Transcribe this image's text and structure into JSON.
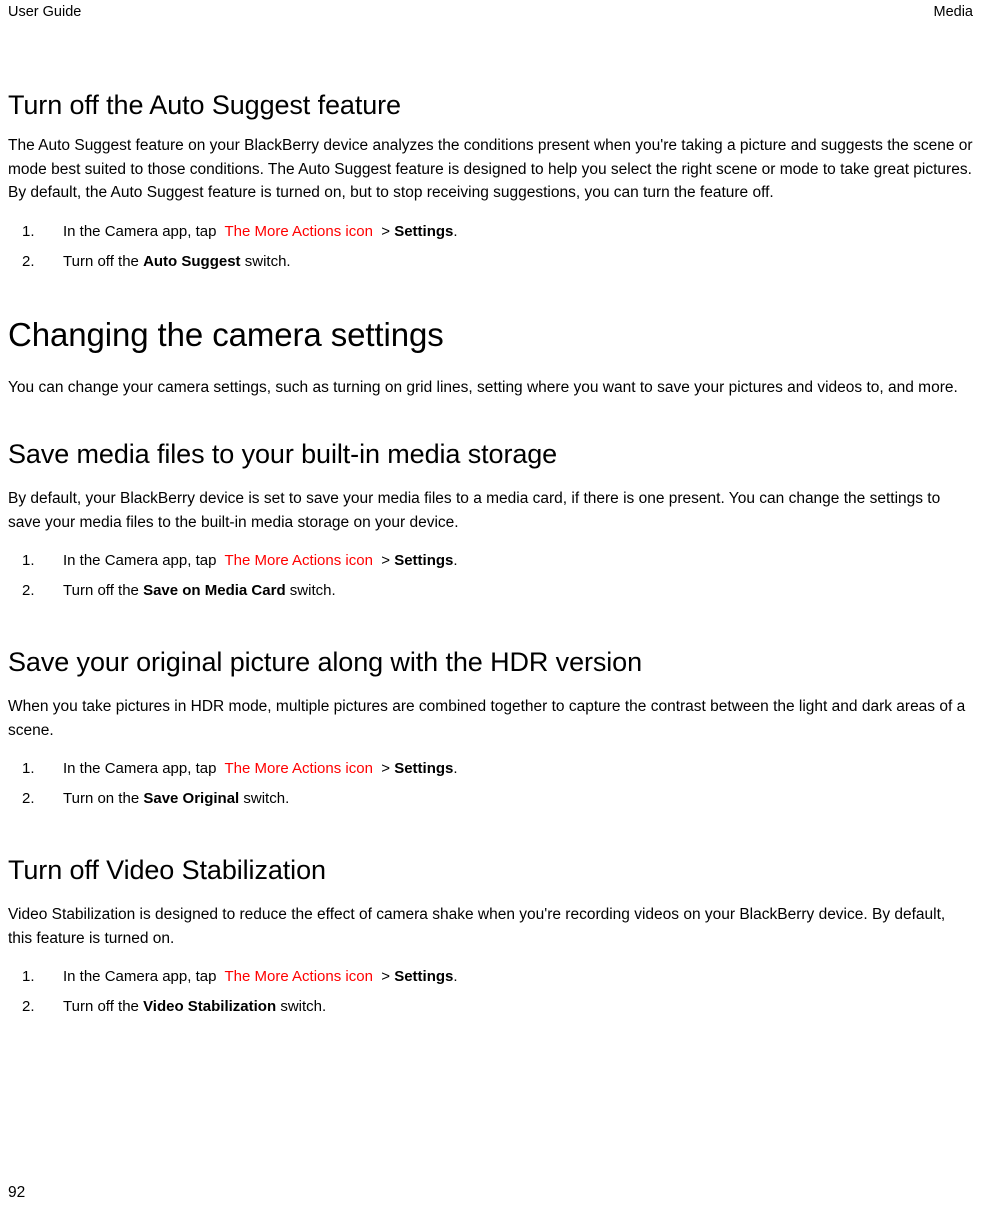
{
  "header": {
    "left": "User Guide",
    "right": "Media"
  },
  "footer": {
    "page_number": "92"
  },
  "colors": {
    "link_red": "#ff0000",
    "text": "#000000",
    "background": "#ffffff"
  },
  "sections": [
    {
      "id": "auto-suggest",
      "level": "h2",
      "title": "Turn off the Auto Suggest feature",
      "paragraph": "The Auto Suggest feature on your BlackBerry device analyzes the conditions present when you're taking a picture and suggests the scene or mode best suited to those conditions. The Auto Suggest feature is designed to help you select the right scene or mode to take great pictures. By default, the Auto Suggest feature is turned on, but to stop receiving suggestions, you can turn the feature off.",
      "steps": [
        {
          "lead": "In the Camera app, tap",
          "link": "The More Actions icon",
          "separator": ">",
          "target": "Settings",
          "trailing": "."
        },
        {
          "lead": "Turn off the",
          "bold": "Auto Suggest",
          "trailing": "switch."
        }
      ]
    },
    {
      "id": "changing-camera-settings",
      "level": "h1",
      "title": "Changing the camera settings",
      "paragraph": "You can change your camera settings, such as turning on grid lines, setting where you want to save your pictures and videos to, and more."
    },
    {
      "id": "save-media-storage",
      "level": "h2",
      "title": "Save media files to your built-in media storage",
      "paragraph": "By default, your BlackBerry device is set to save your media files to a media card, if there is one present. You can change the settings to save your media files to the built-in media storage on your device.",
      "steps": [
        {
          "lead": "In the Camera app, tap",
          "link": "The More Actions icon",
          "separator": ">",
          "target": "Settings",
          "trailing": "."
        },
        {
          "lead": "Turn off the",
          "bold": "Save on Media Card",
          "trailing": "switch."
        }
      ]
    },
    {
      "id": "save-original-hdr",
      "level": "h2",
      "title": "Save your original picture along with the HDR version",
      "paragraph": "When you take pictures in HDR mode, multiple pictures are combined together to capture the contrast between the light and dark areas of a scene.",
      "steps": [
        {
          "lead": "In the Camera app, tap",
          "link": "The More Actions icon",
          "separator": ">",
          "target": "Settings",
          "trailing": "."
        },
        {
          "lead": "Turn on the",
          "bold": "Save Original",
          "trailing": "switch."
        }
      ]
    },
    {
      "id": "video-stabilization",
      "level": "h2",
      "title": "Turn off Video Stabilization",
      "paragraph": "Video Stabilization is designed to reduce the effect of camera shake when you're recording videos on your BlackBerry device. By default, this feature is turned on.",
      "steps": [
        {
          "lead": "In the Camera app, tap",
          "link": "The More Actions icon",
          "separator": ">",
          "target": "Settings",
          "trailing": "."
        },
        {
          "lead": "Turn off the",
          "bold": "Video Stabilization",
          "trailing": "switch."
        }
      ]
    }
  ]
}
